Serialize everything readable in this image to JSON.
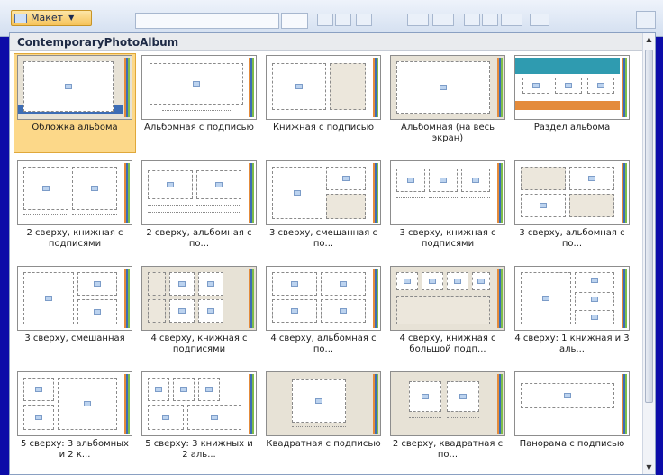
{
  "ribbon": {
    "layout_button_label": "Макет",
    "icons": [
      "layout-icon",
      "dropdown-arrow-icon",
      "font-grow-icon",
      "font-shrink-icon",
      "clear-format-icon",
      "bullets-icon",
      "numbering-icon",
      "decrease-indent-icon",
      "increase-indent-icon",
      "line-spacing-icon",
      "text-direction-icon",
      "shape-icon"
    ]
  },
  "gallery": {
    "header": "ContemporaryPhotoAlbum",
    "selected_index": 0,
    "stripe_colors": [
      "#e48b3b",
      "#3d6db5",
      "#7dbd4a"
    ],
    "layouts": [
      {
        "label": "Обложка альбома"
      },
      {
        "label": "Альбомная с подписью"
      },
      {
        "label": "Книжная с подписью"
      },
      {
        "label": "Альбомная (на весь экран)"
      },
      {
        "label": "Раздел альбома"
      },
      {
        "label": "2 сверху, книжная с подписями"
      },
      {
        "label": "2 сверху, альбомная с по..."
      },
      {
        "label": "3 сверху, смешанная с по..."
      },
      {
        "label": "3 сверху, книжная с подписями"
      },
      {
        "label": "3 сверху, альбомная с по..."
      },
      {
        "label": "3 сверху, смешанная"
      },
      {
        "label": "4 сверху, книжная с подписями"
      },
      {
        "label": "4 сверху, альбомная с по..."
      },
      {
        "label": "4 сверху, книжная с большой подп..."
      },
      {
        "label": "4 сверху: 1 книжная и 3 аль..."
      },
      {
        "label": "5 сверху: 3 альбомных и 2 к..."
      },
      {
        "label": "5 сверху: 3 книжных и 2 аль..."
      },
      {
        "label": "Квадратная с подписью"
      },
      {
        "label": "2 сверху, квадратная с по..."
      },
      {
        "label": "Панорама с подписью"
      }
    ]
  }
}
